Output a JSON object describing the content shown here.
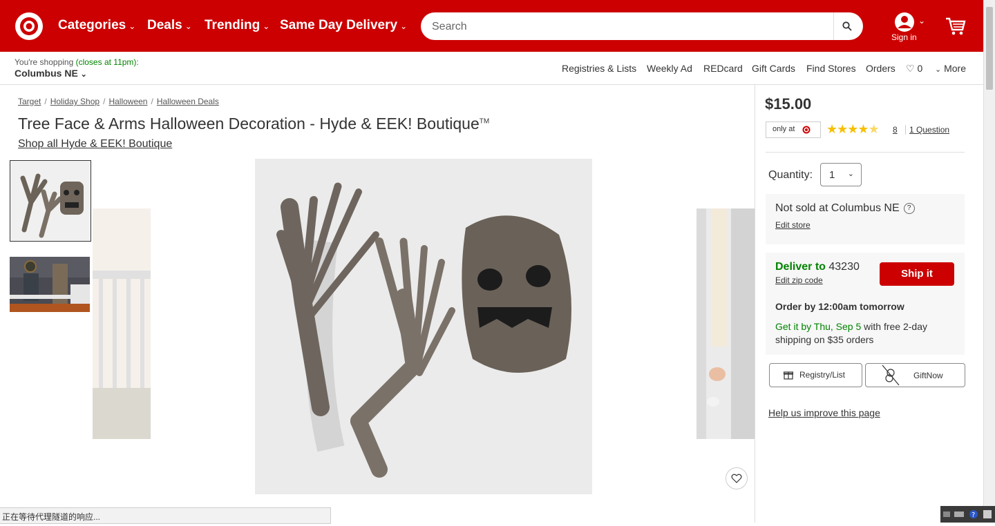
{
  "header": {
    "nav": [
      {
        "label": "Categories"
      },
      {
        "label": "Deals"
      },
      {
        "label": "Trending"
      },
      {
        "label": "Same Day Delivery"
      }
    ],
    "search_placeholder": "Search",
    "signin_label": "Sign in"
  },
  "store": {
    "line1_prefix": "You're shopping ",
    "line1_hours": "(closes at 11pm)",
    "line1_suffix": ":",
    "name": "Columbus NE"
  },
  "utility_links": [
    "Registries & Lists",
    "Weekly Ad",
    "REDcard",
    "Gift Cards",
    "Find Stores",
    "Orders"
  ],
  "favorites_count": "0",
  "more_label": "More",
  "breadcrumbs": [
    "Target",
    "Holiday Shop",
    "Halloween",
    "Halloween Deals"
  ],
  "product": {
    "title": "Tree Face & Arms Halloween Decoration - Hyde & EEK! Boutique",
    "title_mark": "TM",
    "shop_all": "Shop all Hyde & EEK! Boutique",
    "price": "$15.00",
    "only_at": "only at",
    "rating_stars": 4.5,
    "review_count": "8",
    "questions": "1 Question"
  },
  "purchase": {
    "quantity_label": "Quantity:",
    "quantity_value": "1",
    "not_sold": "Not sold at Columbus NE",
    "edit_store": "Edit store",
    "deliver_prefix": "Deliver to",
    "deliver_zip": "43230",
    "edit_zip": "Edit zip code",
    "ship_button": "Ship it",
    "order_by": "Order by 12:00am tomorrow",
    "get_it": "Get it by Thu, Sep 5",
    "get_it_rest": " with free 2-day shipping on $35 orders",
    "registry_button": "Registry/List",
    "giftnow_button": "GiftNow",
    "help_link": "Help us improve this page"
  },
  "status_bar": "正在等待代理隧道的响应...",
  "colors": {
    "brand_red": "#cc0000",
    "green": "#008300",
    "star": "#f6c000"
  }
}
